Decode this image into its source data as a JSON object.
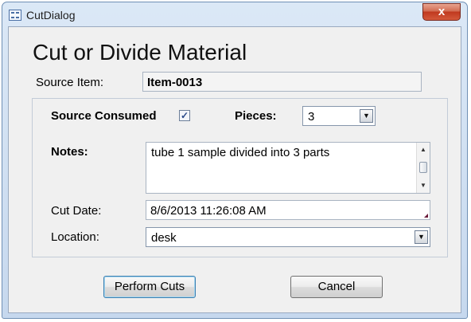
{
  "window": {
    "title": "CutDialog",
    "close_glyph": "x"
  },
  "form": {
    "heading": "Cut or Divide Material",
    "source_item_label": "Source Item:",
    "source_item_value": "Item-0013",
    "source_consumed_label": "Source Consumed",
    "source_consumed_checked": true,
    "pieces_label": "Pieces:",
    "pieces_value": "3",
    "notes_label": "Notes:",
    "notes_value": "tube 1 sample divided into 3 parts",
    "cut_date_label": "Cut Date:",
    "cut_date_value": "8/6/2013 11:26:08 AM",
    "location_label": "Location:",
    "location_value": "desk"
  },
  "buttons": {
    "perform_label": "Perform Cuts",
    "cancel_label": "Cancel"
  },
  "icons": {
    "app": "form-icon",
    "close": "close-icon",
    "check": "checkmark-icon",
    "dropdown": "chevron-down-icon",
    "scroll_up": "scroll-up-arrow-icon",
    "scroll_down": "scroll-down-arrow-icon"
  }
}
